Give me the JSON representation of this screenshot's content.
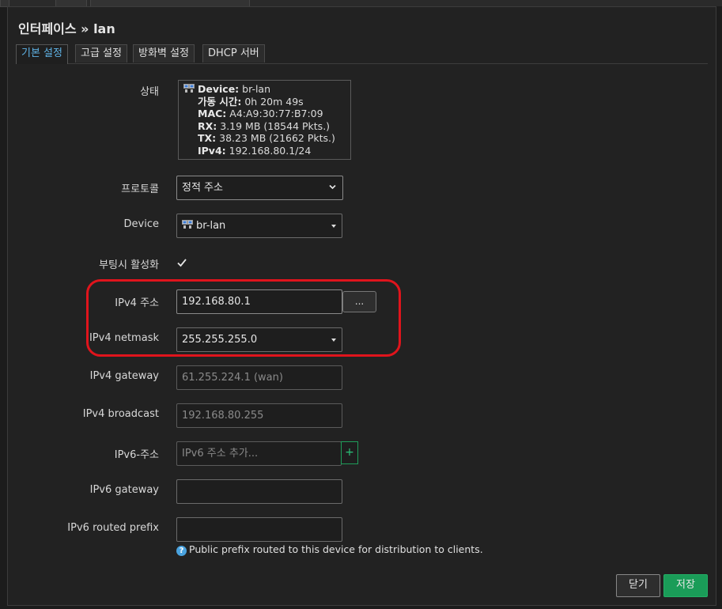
{
  "window": {
    "title": "인터페이스 » lan"
  },
  "tabs": [
    {
      "label": "기본 설정",
      "active": true
    },
    {
      "label": "고급 설정",
      "active": false
    },
    {
      "label": "방화벽 설정",
      "active": false
    },
    {
      "label": "DHCP 서버",
      "active": false
    }
  ],
  "status": {
    "label": "상태",
    "device_key": "Device:",
    "device_val": "br-lan",
    "uptime_key": "가동 시간:",
    "uptime_val": "0h 20m 49s",
    "mac_key": "MAC:",
    "mac_val": "A4:A9:30:77:B7:09",
    "rx_key": "RX:",
    "rx_val": "3.19 MB (18544 Pkts.)",
    "tx_key": "TX:",
    "tx_val": "38.23 MB (21662 Pkts.)",
    "ipv4_key": "IPv4:",
    "ipv4_val": "192.168.80.1/24"
  },
  "fields": {
    "protocol": {
      "label": "프로토콜",
      "value": "정적 주소"
    },
    "device": {
      "label": "Device",
      "value": "br-lan"
    },
    "bringup": {
      "label": "부팅시 활성화",
      "checked": true
    },
    "ipv4_addr": {
      "label": "IPv4 주소",
      "value": "192.168.80.1",
      "button": "..."
    },
    "ipv4_netmask": {
      "label": "IPv4 netmask",
      "value": "255.255.255.0"
    },
    "ipv4_gateway": {
      "label": "IPv4 gateway",
      "placeholder": "61.255.224.1 (wan)"
    },
    "ipv4_broadcast": {
      "label": "IPv4 broadcast",
      "placeholder": "192.168.80.255"
    },
    "ipv6_addr": {
      "label": "IPv6-주소",
      "placeholder": "IPv6 주소 추가...",
      "button": "+"
    },
    "ipv6_gateway": {
      "label": "IPv6 gateway",
      "value": ""
    },
    "ipv6_prefix": {
      "label": "IPv6 routed prefix",
      "value": "",
      "help": "Public prefix routed to this device for distribution to clients."
    }
  },
  "footer": {
    "close_label": "닫기",
    "save_label": "저장"
  },
  "colors": {
    "accent": "#5fb3e6",
    "save": "#1a9c58",
    "highlight": "#e0141c"
  }
}
